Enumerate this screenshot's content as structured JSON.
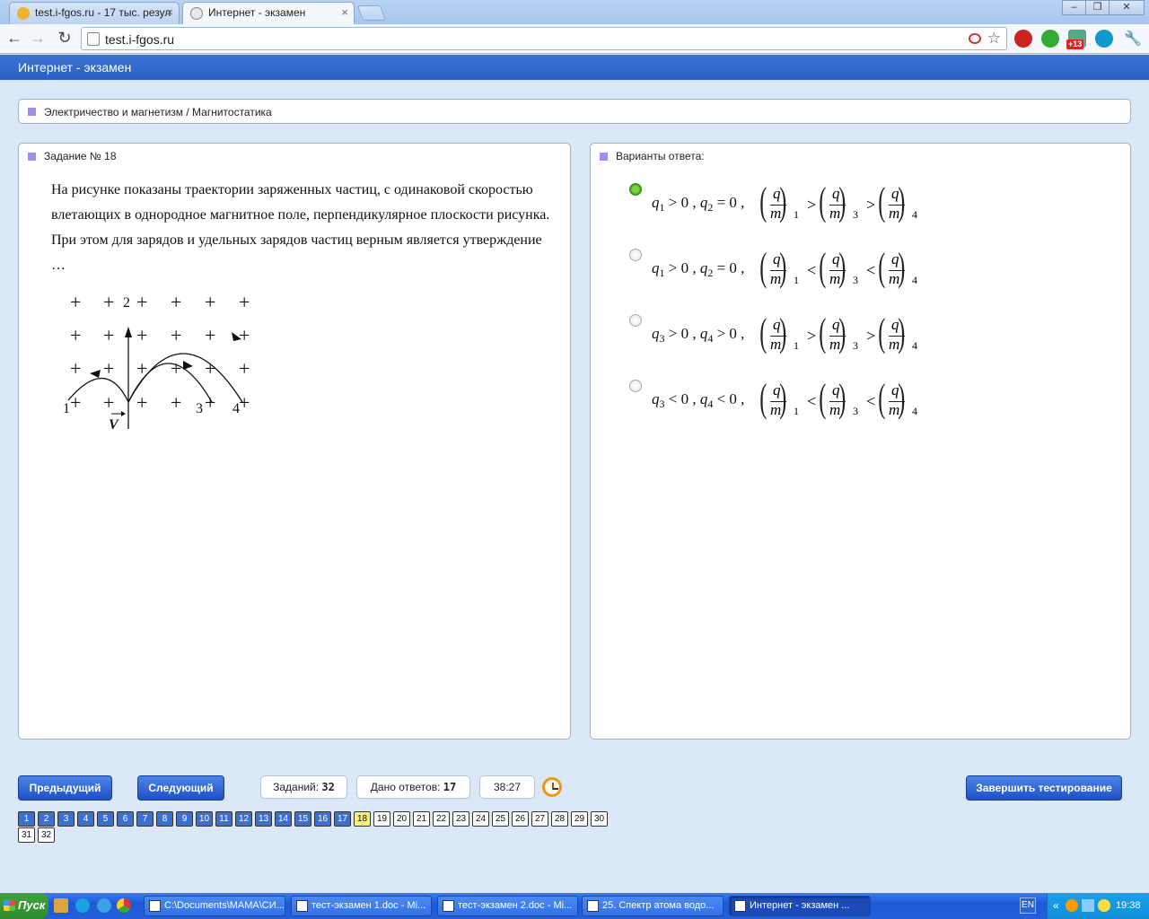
{
  "browser": {
    "tabs": [
      {
        "title": "test.i-fgos.ru - 17 тыс. резул"
      },
      {
        "title": "Интернет - экзамен"
      }
    ],
    "url": "test.i-fgos.ru",
    "extension_badge": "+13"
  },
  "page": {
    "header_title": "Интернет - экзамен",
    "breadcrumb": "Электричество и магнетизм / Магнитостатика",
    "task_title": "Задание № 18",
    "question": "На рисунке показаны траектории заряженных частиц, с одинаковой скоростью влетающих в однородное магнитное поле, перпендикулярное плоскости рисунка. При этом для зарядов и удельных зарядов частиц верным является утверждение …",
    "figure": {
      "field_symbol": "+",
      "trajectory_labels": [
        "1",
        "2",
        "3",
        "4"
      ],
      "velocity_label": "V"
    },
    "answers_title": "Варианты ответа:",
    "answers": [
      {
        "selected": true,
        "a": "q",
        "a_sub": "1",
        "a_rel": "> 0",
        "b": "q",
        "b_sub": "2",
        "b_rel": "= 0",
        "rel": ">",
        "indices": [
          "1",
          "3",
          "4"
        ]
      },
      {
        "selected": false,
        "a": "q",
        "a_sub": "1",
        "a_rel": "> 0",
        "b": "q",
        "b_sub": "2",
        "b_rel": "= 0",
        "rel": "<",
        "indices": [
          "1",
          "3",
          "4"
        ]
      },
      {
        "selected": false,
        "a": "q",
        "a_sub": "3",
        "a_rel": "> 0",
        "b": "q",
        "b_sub": "4",
        "b_rel": "> 0",
        "rel": ">",
        "indices": [
          "1",
          "3",
          "4"
        ]
      },
      {
        "selected": false,
        "a": "q",
        "a_sub": "3",
        "a_rel": "< 0",
        "b": "q",
        "b_sub": "4",
        "b_rel": "< 0",
        "rel": "<",
        "indices": [
          "1",
          "3",
          "4"
        ]
      }
    ],
    "fraction": {
      "num": "q",
      "den": "m"
    }
  },
  "footer": {
    "prev_label": "Предыдущий",
    "next_label": "Следующий",
    "tasks_label": "Заданий:",
    "tasks_value": "32",
    "answered_label": "Дано ответов:",
    "answered_value": "17",
    "timer": "38:27",
    "finish_label": "Завершить тестирование",
    "question_numbers": [
      "1",
      "2",
      "3",
      "4",
      "5",
      "6",
      "7",
      "8",
      "9",
      "10",
      "11",
      "12",
      "13",
      "14",
      "15",
      "16",
      "17",
      "18",
      "19",
      "20",
      "21",
      "22",
      "23",
      "24",
      "25",
      "26",
      "27",
      "28",
      "29",
      "30",
      "31",
      "32"
    ],
    "answered_count": 17,
    "current": "18"
  },
  "taskbar": {
    "start_label": "Пуск",
    "tasks": [
      {
        "label": "C:\\Documents\\МАМА\\СИ...",
        "active": false
      },
      {
        "label": "тест-экзамен 1.doc - Mi...",
        "active": false
      },
      {
        "label": "тест-экзамен 2.doc - Mi...",
        "active": false
      },
      {
        "label": "25. Спектр атома водо...",
        "active": false
      },
      {
        "label": "Интернет - экзамен ...",
        "active": true
      }
    ],
    "language": "EN",
    "time": "19:38"
  },
  "colors": {
    "accent": "#2b5fc2",
    "selected_radio": "#3e9b17",
    "current_question": "#f8f070"
  }
}
